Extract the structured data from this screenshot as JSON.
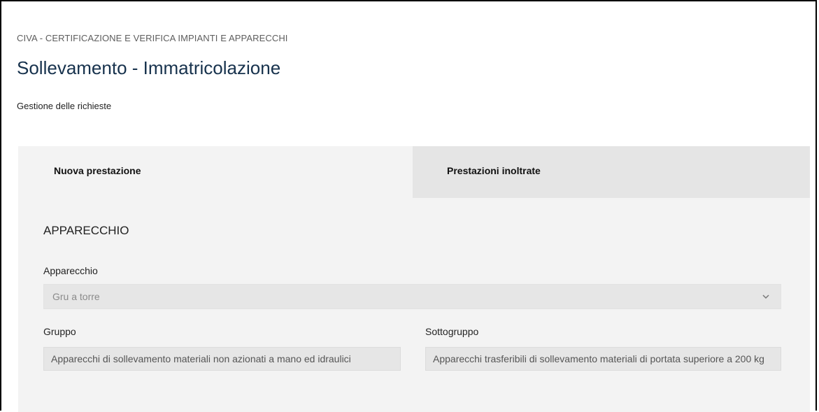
{
  "header": {
    "breadcrumb": "CIVA - CERTIFICAZIONE E VERIFICA IMPIANTI E APPARECCHI",
    "title": "Sollevamento - Immatricolazione",
    "subtitle": "Gestione delle richieste"
  },
  "tabs": [
    {
      "label": "Nuova prestazione",
      "active": true
    },
    {
      "label": "Prestazioni inoltrate",
      "active": false
    }
  ],
  "form": {
    "section_title": "APPARECCHIO",
    "apparecchio": {
      "label": "Apparecchio",
      "value": "Gru a torre"
    },
    "gruppo": {
      "label": "Gruppo",
      "value": "Apparecchi di sollevamento materiali non azionati a mano ed idraulici"
    },
    "sottogruppo": {
      "label": "Sottogruppo",
      "value": "Apparecchi trasferibili di sollevamento materiali di portata superiore a 200 kg"
    }
  },
  "colors": {
    "title": "#17324d",
    "panel_bg": "#f3f3f3",
    "inactive_tab_bg": "#e5e5e5",
    "field_bg": "#e6e6e6"
  },
  "icons": {
    "select_chevron": "chevron-down-icon"
  }
}
